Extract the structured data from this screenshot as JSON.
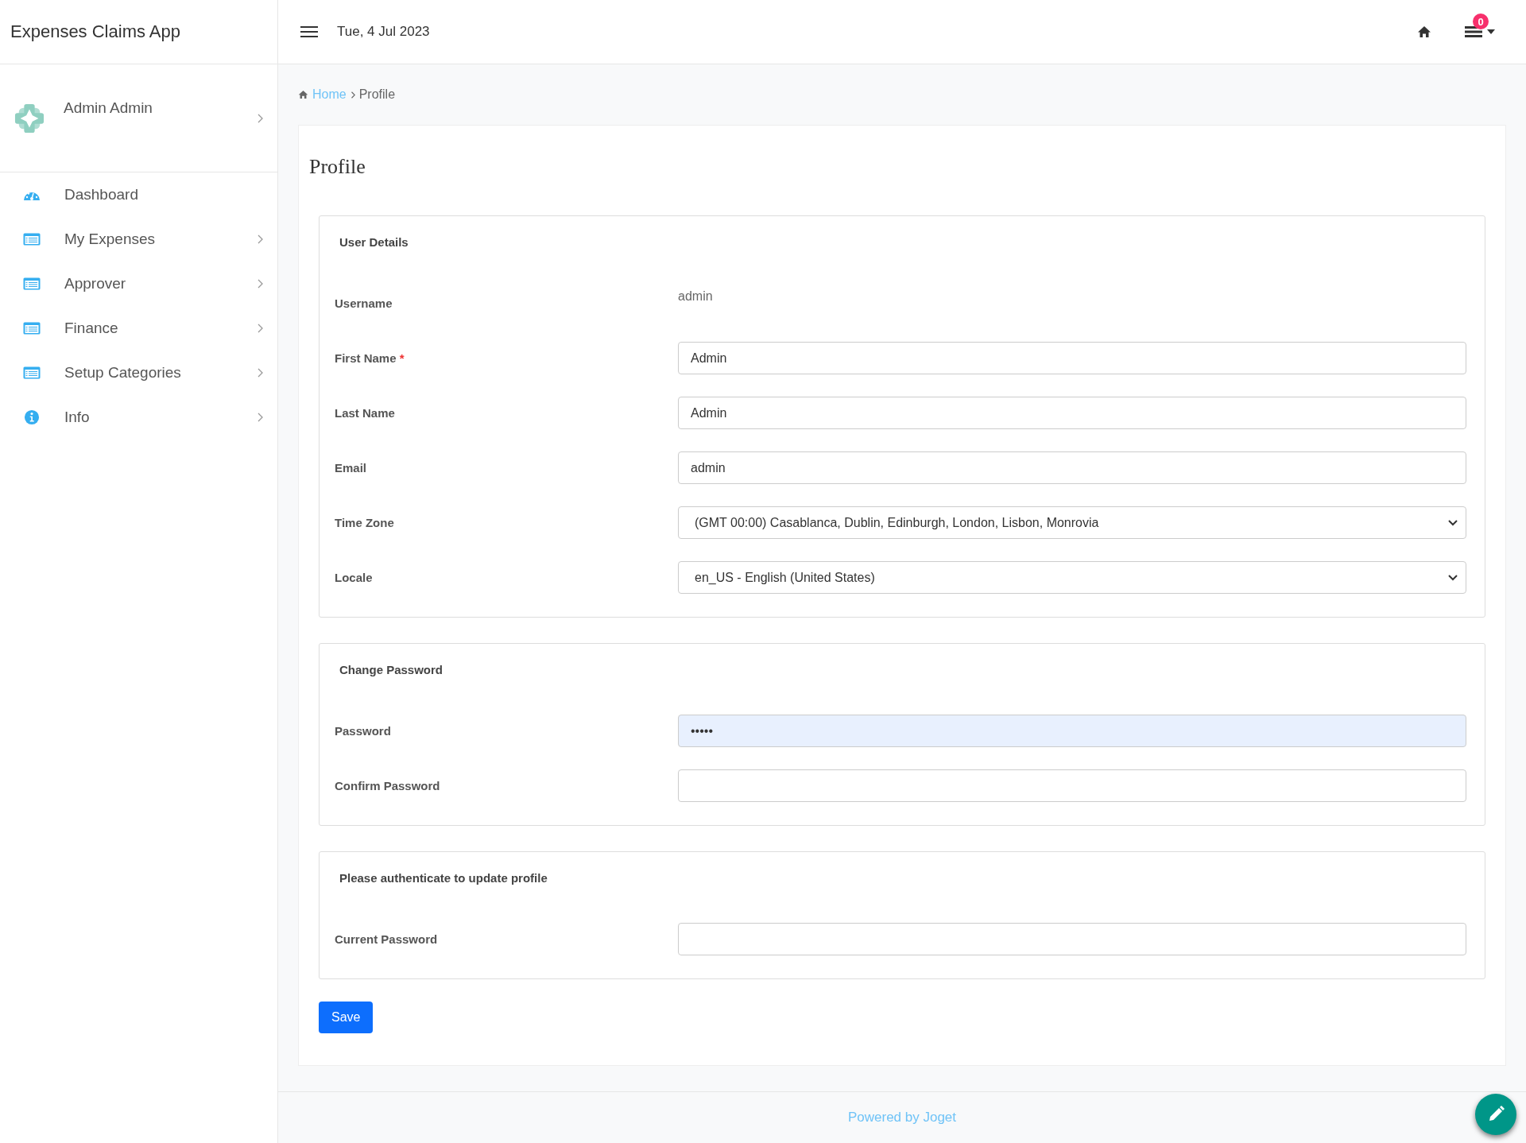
{
  "app_title": "Expenses Claims App",
  "user": {
    "name": "Admin Admin"
  },
  "sidebar": {
    "items": [
      {
        "label": "Dashboard",
        "kind": "dashboard",
        "has_submenu": false
      },
      {
        "label": "My Expenses",
        "kind": "list",
        "has_submenu": true
      },
      {
        "label": "Approver",
        "kind": "list",
        "has_submenu": true
      },
      {
        "label": "Finance",
        "kind": "list",
        "has_submenu": true
      },
      {
        "label": "Setup Categories",
        "kind": "list",
        "has_submenu": true
      },
      {
        "label": "Info",
        "kind": "info",
        "has_submenu": true
      }
    ]
  },
  "header": {
    "date": "Tue, 4 Jul 2023",
    "notification_count": "0"
  },
  "breadcrumb": {
    "home": "Home",
    "current": "Profile"
  },
  "page_title": "Profile",
  "sections": [
    {
      "title": "User Details",
      "fields": [
        {
          "label": "Username",
          "kind": "static",
          "value": "admin"
        },
        {
          "label": "First Name",
          "required_mark": "*",
          "kind": "input",
          "value": "Admin"
        },
        {
          "label": "Last Name",
          "kind": "input",
          "value": "Admin"
        },
        {
          "label": "Email",
          "kind": "input",
          "value": "admin"
        },
        {
          "label": "Time Zone",
          "kind": "select",
          "value": "(GMT 00:00) Casablanca, Dublin, Edinburgh, London, Lisbon, Monrovia"
        },
        {
          "label": "Locale",
          "kind": "select",
          "value": "en_US - English (United States)"
        }
      ]
    },
    {
      "title": "Change Password",
      "fields": [
        {
          "label": "Password",
          "kind": "password",
          "autofilled": true,
          "value": "•••••"
        },
        {
          "label": "Confirm Password",
          "kind": "password",
          "autofilled": false
        }
      ]
    },
    {
      "title": "Please authenticate to update profile",
      "fields": [
        {
          "label": "Current Password",
          "kind": "password",
          "autofilled": false
        }
      ]
    }
  ],
  "save_button": "Save",
  "footer": "Powered by Joget"
}
